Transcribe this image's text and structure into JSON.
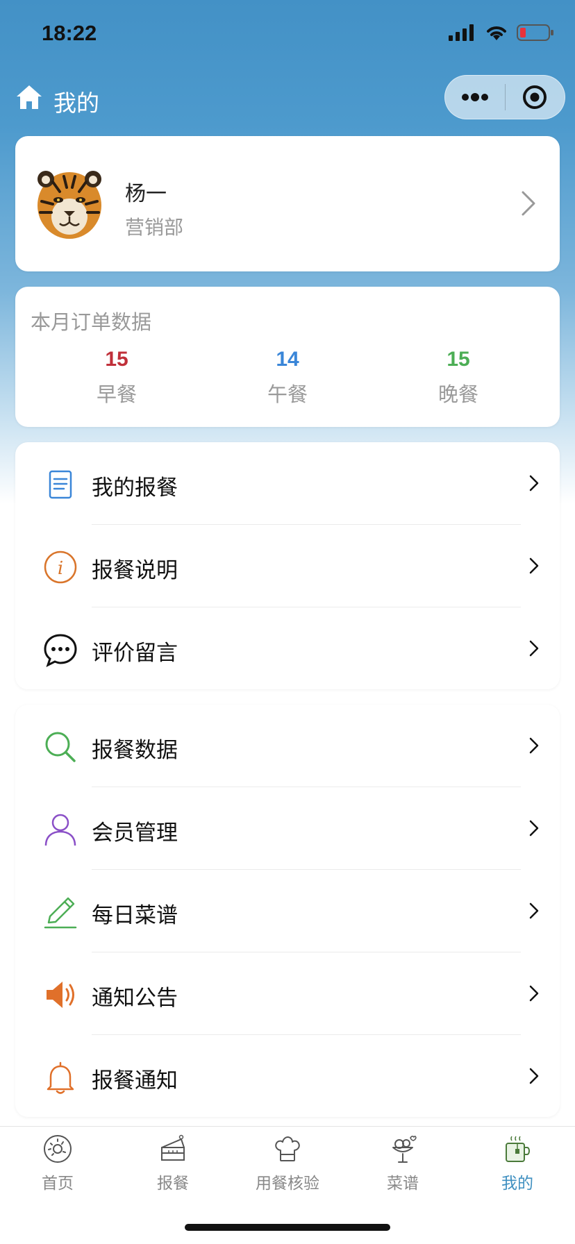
{
  "status_bar": {
    "time": "18:22"
  },
  "nav": {
    "title": "我的",
    "icons": [
      "home-icon",
      "more-icon",
      "close-icon"
    ]
  },
  "profile": {
    "name": "杨一",
    "department": "营销部"
  },
  "stats": {
    "title": "本月订单数据",
    "items": [
      {
        "value": "15",
        "label": "早餐",
        "color": "#c0303a"
      },
      {
        "value": "14",
        "label": "午餐",
        "color": "#3a86d8"
      },
      {
        "value": "15",
        "label": "晚餐",
        "color": "#4cae55"
      }
    ]
  },
  "menu_group_1": [
    {
      "label": "我的报餐",
      "icon": "document-icon",
      "color": "#3a86d8"
    },
    {
      "label": "报餐说明",
      "icon": "info-icon",
      "color": "#d9752b"
    },
    {
      "label": "评价留言",
      "icon": "chat-icon",
      "color": "#111111"
    }
  ],
  "menu_group_2": [
    {
      "label": "报餐数据",
      "icon": "search-icon",
      "color": "#4cae55"
    },
    {
      "label": "会员管理",
      "icon": "user-icon",
      "color": "#8a4fc7"
    },
    {
      "label": "每日菜谱",
      "icon": "pencil-icon",
      "color": "#4cae55"
    },
    {
      "label": "通知公告",
      "icon": "speaker-icon",
      "color": "#e0702a"
    },
    {
      "label": "报餐通知",
      "icon": "bell-icon",
      "color": "#e0702a"
    }
  ],
  "tabs": [
    {
      "label": "首页",
      "icon": "donut-icon",
      "active": false
    },
    {
      "label": "报餐",
      "icon": "cake-icon",
      "active": false
    },
    {
      "label": "用餐核验",
      "icon": "chef-hat-icon",
      "active": false
    },
    {
      "label": "菜谱",
      "icon": "ice-cream-icon",
      "active": false
    },
    {
      "label": "我的",
      "icon": "coffee-cup-icon",
      "active": true
    }
  ],
  "colors": {
    "header_blue": "#4391c6",
    "active_tab": "#3e8fc0"
  }
}
